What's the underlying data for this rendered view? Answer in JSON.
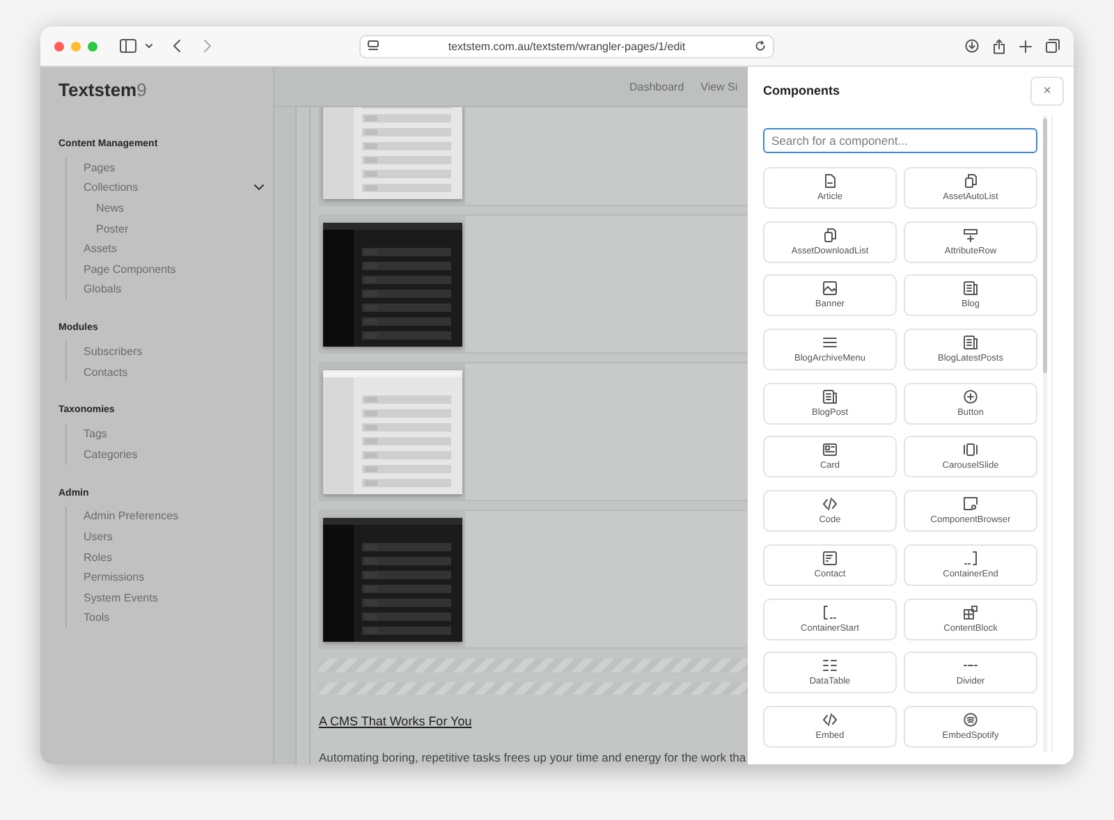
{
  "browser": {
    "url": "textstem.com.au/textstem/wrangler-pages/1/edit"
  },
  "sidebar": {
    "brand": {
      "name": "Textstem",
      "version": "9"
    },
    "sections": [
      {
        "title": "Content Management",
        "items": [
          {
            "label": "Pages"
          },
          {
            "label": "Collections",
            "expanded": true,
            "children": [
              {
                "label": "News"
              },
              {
                "label": "Poster"
              }
            ]
          },
          {
            "label": "Assets"
          },
          {
            "label": "Page Components"
          },
          {
            "label": "Globals"
          }
        ]
      },
      {
        "title": "Modules",
        "items": [
          {
            "label": "Subscribers"
          },
          {
            "label": "Contacts"
          }
        ]
      },
      {
        "title": "Taxonomies",
        "items": [
          {
            "label": "Tags"
          },
          {
            "label": "Categories"
          }
        ]
      },
      {
        "title": "Admin",
        "items": [
          {
            "label": "Admin Preferences"
          },
          {
            "label": "Users"
          },
          {
            "label": "Roles"
          },
          {
            "label": "Permissions"
          },
          {
            "label": "System Events"
          },
          {
            "label": "Tools"
          }
        ]
      }
    ]
  },
  "topbar": {
    "links": [
      "Dashboard",
      "View Si"
    ]
  },
  "content": {
    "heading": "A CMS That Works For You",
    "paragraph": "Automating boring, repetitive tasks frees up your time and energy for the work tha"
  },
  "drawer": {
    "title": "Components",
    "close": "×",
    "search": {
      "placeholder": "Search for a component..."
    },
    "components": [
      "Article",
      "AssetAutoList",
      "AssetDownloadList",
      "AttributeRow",
      "Banner",
      "Blog",
      "BlogArchiveMenu",
      "BlogLatestPosts",
      "BlogPost",
      "Button",
      "Card",
      "CarouselSlide",
      "Code",
      "ComponentBrowser",
      "Contact",
      "ContainerEnd",
      "ContainerStart",
      "ContentBlock",
      "DataTable",
      "Divider",
      "Embed",
      "EmbedSpotify"
    ]
  }
}
